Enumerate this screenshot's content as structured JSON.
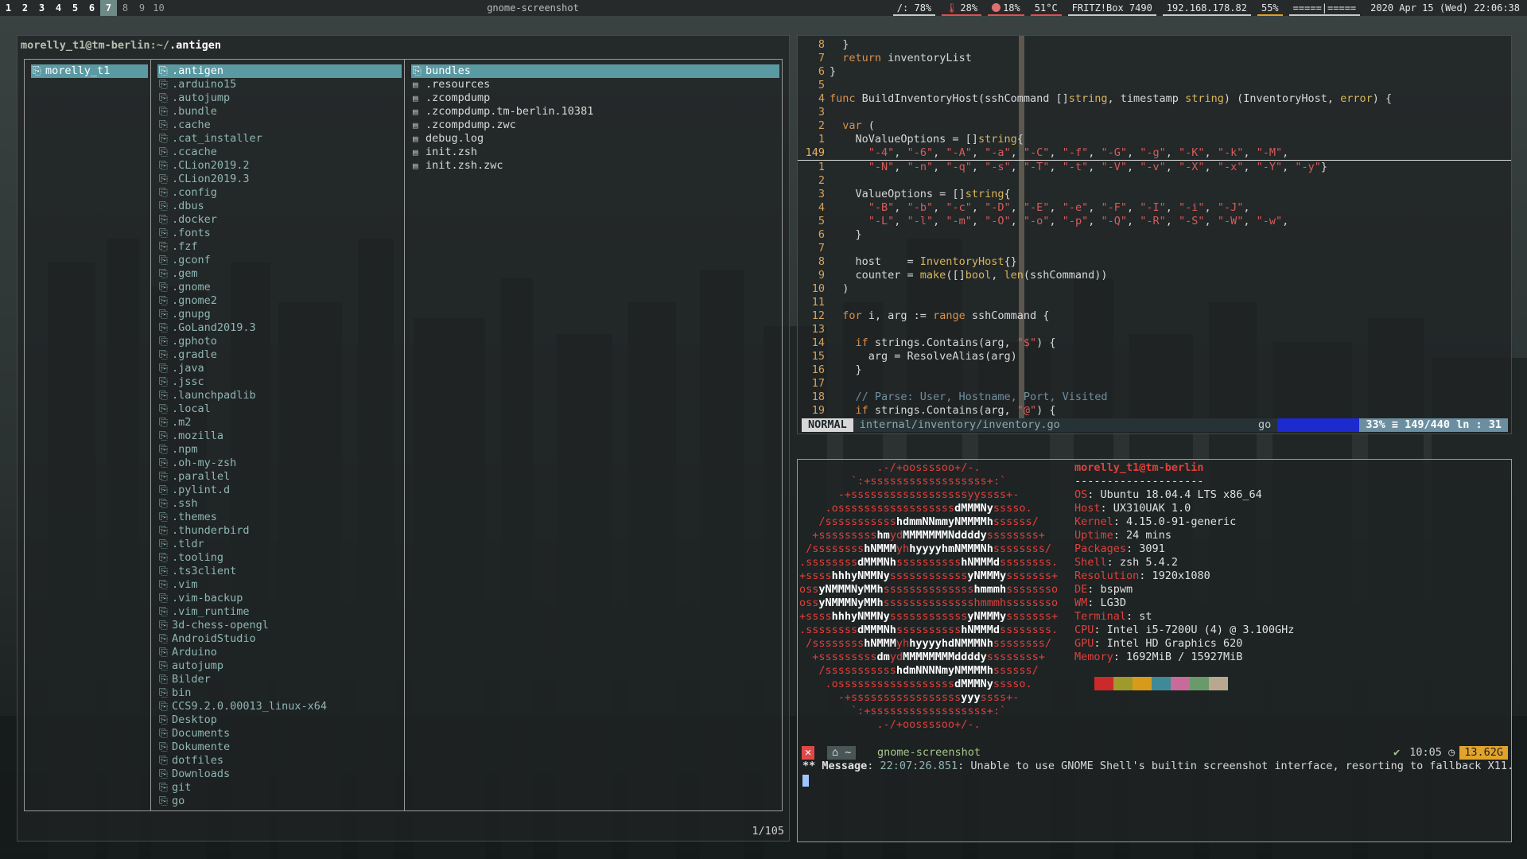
{
  "topbar": {
    "workspaces": [
      {
        "label": "1",
        "state": "occupied"
      },
      {
        "label": "2",
        "state": "occupied"
      },
      {
        "label": "3",
        "state": "occupied"
      },
      {
        "label": "4",
        "state": "occupied"
      },
      {
        "label": "5",
        "state": "occupied"
      },
      {
        "label": "6",
        "state": "occupied"
      },
      {
        "label": "7",
        "state": "active"
      },
      {
        "label": "8",
        "state": "empty"
      },
      {
        "label": "9",
        "state": "empty"
      },
      {
        "label": "10",
        "state": "empty"
      }
    ],
    "window_title": "gnome-screenshot",
    "status": {
      "disk": "/: 78%",
      "temp_percent": "28%",
      "cpu_percent": "18%",
      "cpu_temp": "51°C",
      "wifi": "FRITZ!Box 7490",
      "ip": "192.168.178.82",
      "battery": "55%",
      "volume": "=====|=====",
      "datetime": "2020 Apr 15 (Wed) 22:06:38"
    },
    "colors": {
      "disk": "#c8c8c8",
      "temp": "#e05050",
      "cpu": "#e05050",
      "cputemp": "#e05050",
      "wifi": "#c8c8c8",
      "ip": "#c8c8c8",
      "battery": "#e0a020",
      "volume": "#c8c8c8"
    }
  },
  "ranger": {
    "path_user_host": "morelly_t1@tm-berlin",
    "path_parent": ":~/",
    "path_current": ".antigen",
    "col1": [
      {
        "name": "morelly_t1",
        "type": "dir",
        "selected": true
      }
    ],
    "col2": [
      {
        "name": ".antigen",
        "selected": true
      },
      {
        "name": ".arduino15"
      },
      {
        "name": ".autojump"
      },
      {
        "name": ".bundle"
      },
      {
        "name": ".cache"
      },
      {
        "name": ".cat_installer"
      },
      {
        "name": ".ccache"
      },
      {
        "name": ".CLion2019.2"
      },
      {
        "name": ".CLion2019.3"
      },
      {
        "name": ".config"
      },
      {
        "name": ".dbus"
      },
      {
        "name": ".docker"
      },
      {
        "name": ".fonts"
      },
      {
        "name": ".fzf"
      },
      {
        "name": ".gconf"
      },
      {
        "name": ".gem"
      },
      {
        "name": ".gnome"
      },
      {
        "name": ".gnome2"
      },
      {
        "name": ".gnupg"
      },
      {
        "name": ".GoLand2019.3"
      },
      {
        "name": ".gphoto"
      },
      {
        "name": ".gradle"
      },
      {
        "name": ".java"
      },
      {
        "name": ".jssc"
      },
      {
        "name": ".launchpadlib"
      },
      {
        "name": ".local"
      },
      {
        "name": ".m2"
      },
      {
        "name": ".mozilla"
      },
      {
        "name": ".npm"
      },
      {
        "name": ".oh-my-zsh"
      },
      {
        "name": ".parallel"
      },
      {
        "name": ".pylint.d"
      },
      {
        "name": ".ssh"
      },
      {
        "name": ".themes"
      },
      {
        "name": ".thunderbird"
      },
      {
        "name": ".tldr"
      },
      {
        "name": ".tooling"
      },
      {
        "name": ".ts3client"
      },
      {
        "name": ".vim"
      },
      {
        "name": ".vim-backup"
      },
      {
        "name": ".vim_runtime"
      },
      {
        "name": "3d-chess-opengl"
      },
      {
        "name": "AndroidStudio"
      },
      {
        "name": "Arduino"
      },
      {
        "name": "autojump"
      },
      {
        "name": "Bilder"
      },
      {
        "name": "bin"
      },
      {
        "name": "CCS9.2.0.00013_linux-x64"
      },
      {
        "name": "Desktop"
      },
      {
        "name": "Documents"
      },
      {
        "name": "Dokumente"
      },
      {
        "name": "dotfiles"
      },
      {
        "name": "Downloads"
      },
      {
        "name": "git"
      },
      {
        "name": "go"
      }
    ],
    "col3": [
      {
        "name": "bundles",
        "type": "dir",
        "selected": true
      },
      {
        "name": ".resources",
        "type": "file"
      },
      {
        "name": ".zcompdump",
        "type": "file"
      },
      {
        "name": ".zcompdump.tm-berlin.10381",
        "type": "file"
      },
      {
        "name": ".zcompdump.zwc",
        "type": "file"
      },
      {
        "name": "debug.log",
        "type": "file"
      },
      {
        "name": "init.zsh",
        "type": "file"
      },
      {
        "name": "init.zsh.zwc",
        "type": "file"
      }
    ],
    "count": "1/105"
  },
  "vim": {
    "lines": [
      {
        "n": "8",
        "t": [
          [
            "tx",
            "  }"
          ]
        ]
      },
      {
        "n": "7",
        "t": [
          [
            "tx",
            "  "
          ],
          [
            "kw",
            "return"
          ],
          [
            "tx",
            " inventoryList"
          ]
        ]
      },
      {
        "n": "6",
        "t": [
          [
            "tx",
            "}"
          ]
        ]
      },
      {
        "n": "5",
        "t": [
          [
            "tx",
            ""
          ]
        ]
      },
      {
        "n": "4",
        "t": [
          [
            "kw",
            "func"
          ],
          [
            "tx",
            " BuildInventoryHost(sshCommand []"
          ],
          [
            "ty",
            "string"
          ],
          [
            "tx",
            ", timestamp "
          ],
          [
            "ty",
            "string"
          ],
          [
            "tx",
            ") (InventoryHost, "
          ],
          [
            "ty",
            "error"
          ],
          [
            "tx",
            ") {"
          ]
        ]
      },
      {
        "n": "3",
        "t": [
          [
            "tx",
            ""
          ]
        ]
      },
      {
        "n": "2",
        "t": [
          [
            "tx",
            "  "
          ],
          [
            "kw",
            "var"
          ],
          [
            "tx",
            " ("
          ]
        ]
      },
      {
        "n": "1",
        "t": [
          [
            "tx",
            "    NoValueOptions = []"
          ],
          [
            "ty",
            "string"
          ],
          [
            "tx",
            "{"
          ]
        ]
      },
      {
        "n": "149",
        "cur": true,
        "t": [
          [
            "tx",
            "      "
          ],
          [
            "str",
            "\"-4\""
          ],
          [
            "tx",
            ", "
          ],
          [
            "str",
            "\"-6\""
          ],
          [
            "tx",
            ", "
          ],
          [
            "str",
            "\"-A\""
          ],
          [
            "tx",
            ", "
          ],
          [
            "str",
            "\"-a\""
          ],
          [
            "tx",
            ", "
          ],
          [
            "str",
            "\"-C\""
          ],
          [
            "tx",
            ", "
          ],
          [
            "str",
            "\"-f\""
          ],
          [
            "tx",
            ", "
          ],
          [
            "str",
            "\"-G\""
          ],
          [
            "tx",
            ", "
          ],
          [
            "str",
            "\"-g\""
          ],
          [
            "tx",
            ", "
          ],
          [
            "str",
            "\"-K\""
          ],
          [
            "tx",
            ", "
          ],
          [
            "str",
            "\"-k\""
          ],
          [
            "tx",
            ", "
          ],
          [
            "str",
            "\"-M\""
          ],
          [
            "tx",
            ","
          ]
        ]
      },
      {
        "n": "1",
        "t": [
          [
            "tx",
            "      "
          ],
          [
            "str",
            "\"-N\""
          ],
          [
            "tx",
            ", "
          ],
          [
            "str",
            "\"-n\""
          ],
          [
            "tx",
            ", "
          ],
          [
            "str",
            "\"-q\""
          ],
          [
            "tx",
            ", "
          ],
          [
            "str",
            "\"-s\""
          ],
          [
            "tx",
            ", "
          ],
          [
            "str",
            "\"-T\""
          ],
          [
            "tx",
            ", "
          ],
          [
            "str",
            "\"-t\""
          ],
          [
            "tx",
            ", "
          ],
          [
            "str",
            "\"-V\""
          ],
          [
            "tx",
            ", "
          ],
          [
            "str",
            "\"-v\""
          ],
          [
            "tx",
            ", "
          ],
          [
            "str",
            "\"-X\""
          ],
          [
            "tx",
            ", "
          ],
          [
            "str",
            "\"-x\""
          ],
          [
            "tx",
            ", "
          ],
          [
            "str",
            "\"-Y\""
          ],
          [
            "tx",
            ", "
          ],
          [
            "str",
            "\"-y\""
          ],
          [
            "tx",
            "}"
          ]
        ]
      },
      {
        "n": "2",
        "t": [
          [
            "tx",
            ""
          ]
        ]
      },
      {
        "n": "3",
        "t": [
          [
            "tx",
            "    ValueOptions = []"
          ],
          [
            "ty",
            "string"
          ],
          [
            "tx",
            "{"
          ]
        ]
      },
      {
        "n": "4",
        "t": [
          [
            "tx",
            "      "
          ],
          [
            "str",
            "\"-B\""
          ],
          [
            "tx",
            ", "
          ],
          [
            "str",
            "\"-b\""
          ],
          [
            "tx",
            ", "
          ],
          [
            "str",
            "\"-c\""
          ],
          [
            "tx",
            ", "
          ],
          [
            "str",
            "\"-D\""
          ],
          [
            "tx",
            ", "
          ],
          [
            "str",
            "\"-E\""
          ],
          [
            "tx",
            ", "
          ],
          [
            "str",
            "\"-e\""
          ],
          [
            "tx",
            ", "
          ],
          [
            "str",
            "\"-F\""
          ],
          [
            "tx",
            ", "
          ],
          [
            "str",
            "\"-I\""
          ],
          [
            "tx",
            ", "
          ],
          [
            "str",
            "\"-i\""
          ],
          [
            "tx",
            ", "
          ],
          [
            "str",
            "\"-J\""
          ],
          [
            "tx",
            ","
          ]
        ]
      },
      {
        "n": "5",
        "t": [
          [
            "tx",
            "      "
          ],
          [
            "str",
            "\"-L\""
          ],
          [
            "tx",
            ", "
          ],
          [
            "str",
            "\"-l\""
          ],
          [
            "tx",
            ", "
          ],
          [
            "str",
            "\"-m\""
          ],
          [
            "tx",
            ", "
          ],
          [
            "str",
            "\"-O\""
          ],
          [
            "tx",
            ", "
          ],
          [
            "str",
            "\"-o\""
          ],
          [
            "tx",
            ", "
          ],
          [
            "str",
            "\"-p\""
          ],
          [
            "tx",
            ", "
          ],
          [
            "str",
            "\"-Q\""
          ],
          [
            "tx",
            ", "
          ],
          [
            "str",
            "\"-R\""
          ],
          [
            "tx",
            ", "
          ],
          [
            "str",
            "\"-S\""
          ],
          [
            "tx",
            ", "
          ],
          [
            "str",
            "\"-W\""
          ],
          [
            "tx",
            ", "
          ],
          [
            "str",
            "\"-w\""
          ],
          [
            "tx",
            ","
          ]
        ]
      },
      {
        "n": "6",
        "t": [
          [
            "tx",
            "    }"
          ]
        ]
      },
      {
        "n": "7",
        "t": [
          [
            "tx",
            ""
          ]
        ]
      },
      {
        "n": "8",
        "t": [
          [
            "tx",
            "    host    = "
          ],
          [
            "ty",
            "InventoryHost"
          ],
          [
            "tx",
            "{}"
          ]
        ]
      },
      {
        "n": "9",
        "t": [
          [
            "tx",
            "    counter = "
          ],
          [
            "ty",
            "make"
          ],
          [
            "tx",
            "([]"
          ],
          [
            "ty",
            "bool"
          ],
          [
            "tx",
            ", "
          ],
          [
            "ty",
            "len"
          ],
          [
            "tx",
            "(sshCommand))"
          ]
        ]
      },
      {
        "n": "10",
        "t": [
          [
            "tx",
            "  )"
          ]
        ]
      },
      {
        "n": "11",
        "t": [
          [
            "tx",
            ""
          ]
        ]
      },
      {
        "n": "12",
        "t": [
          [
            "tx",
            "  "
          ],
          [
            "kw",
            "for"
          ],
          [
            "tx",
            " i, arg := "
          ],
          [
            "kw",
            "range"
          ],
          [
            "tx",
            " sshCommand {"
          ]
        ]
      },
      {
        "n": "13",
        "t": [
          [
            "tx",
            ""
          ]
        ]
      },
      {
        "n": "14",
        "t": [
          [
            "tx",
            "    "
          ],
          [
            "kw",
            "if"
          ],
          [
            "tx",
            " strings.Contains(arg, "
          ],
          [
            "str",
            "\"$\""
          ],
          [
            "tx",
            ") {"
          ]
        ]
      },
      {
        "n": "15",
        "t": [
          [
            "tx",
            "      arg = ResolveAlias(arg)"
          ]
        ]
      },
      {
        "n": "16",
        "t": [
          [
            "tx",
            "    }"
          ]
        ]
      },
      {
        "n": "17",
        "t": [
          [
            "tx",
            ""
          ]
        ]
      },
      {
        "n": "18",
        "t": [
          [
            "tx",
            "    "
          ],
          [
            "cm",
            "// Parse: User, Hostname, Port, Visited"
          ]
        ]
      },
      {
        "n": "19",
        "t": [
          [
            "tx",
            "    "
          ],
          [
            "kw",
            "if"
          ],
          [
            "tx",
            " strings.Contains(arg, "
          ],
          [
            "str",
            "\"@\""
          ],
          [
            "tx",
            ") {"
          ]
        ]
      }
    ],
    "status": {
      "mode": "NORMAL",
      "file": "internal/inventory/inventory.go",
      "filetype": "go",
      "position": "33%  ≡  149/440 ln : 31"
    }
  },
  "neofetch": {
    "logo": [
      "            .-/+oossssoo+/-.",
      "        `:+ssssssssssssssssss+:`",
      "      -+ssssssssssssssssssyyssss+-",
      "    .ossssssssssssssssss[b]dMMMNy[/b]sssso.",
      "   /sssssssssss[b]hdmmNNmmyNMMMMh[/b]ssssss/",
      "  +sssssssss[b]hm[/b]yd[b]MMMMMMMNddddy[/b]ssssssss+",
      " /ssssssss[b]hNMMM[/b]yh[b]hyyyyhmNMMMNh[/b]ssssssss/",
      ".ssssssss[b]dMMMNh[/b]ssssssssss[b]hNMMMd[/b]ssssssss.",
      "+ssss[b]hhhyNMMNy[/b]ssssssssssss[b]yNMMMy[/b]sssssss+",
      "oss[b]yNMMMNyMMh[/b]ssssssssssssss[b]hmmmh[/b]ssssssso",
      "oss[b]yNMMMNyMMh[/b]sssssssssssssshmmmhssssssso",
      "+ssss[b]hhhyNMMNy[/b]ssssssssssss[b]yNMMMy[/b]sssssss+",
      ".ssssssss[b]dMMMNh[/b]ssssssssss[b]hNMMMd[/b]ssssssss.",
      " /ssssssss[b]hNMMM[/b]yh[b]hyyyyhdNMMMNh[/b]ssssssss/",
      "  +sssssssss[b]dm[/b]yd[b]MMMMMMMMddddy[/b]ssssssss+",
      "   /sssssssssss[b]hdmNNNNmyNMMMMh[/b]ssssss/",
      "    .ossssssssssssssssss[b]dMMMNy[/b]sssso.",
      "      -+sssssssssssssssss[b]yyy[/b]ssss+-",
      "        `:+ssssssssssssssssss+:`",
      "            .-/+oossssoo+/-."
    ],
    "user_host": "morelly_t1@tm-berlin",
    "separator": "--------------------",
    "fields": [
      {
        "k": "OS",
        "v": "Ubuntu 18.04.4 LTS x86_64"
      },
      {
        "k": "Host",
        "v": "UX310UAK 1.0"
      },
      {
        "k": "Kernel",
        "v": "4.15.0-91-generic"
      },
      {
        "k": "Uptime",
        "v": "24 mins"
      },
      {
        "k": "Packages",
        "v": "3091"
      },
      {
        "k": "Shell",
        "v": "zsh 5.4.2"
      },
      {
        "k": "Resolution",
        "v": "1920x1080"
      },
      {
        "k": "DE",
        "v": "bspwm"
      },
      {
        "k": "WM",
        "v": "LG3D"
      },
      {
        "k": "Terminal",
        "v": "st"
      },
      {
        "k": "CPU",
        "v": "Intel i5-7200U (4) @ 3.100GHz"
      },
      {
        "k": "GPU",
        "v": "Intel HD Graphics 620"
      },
      {
        "k": "Memory",
        "v": "1692MiB / 15927MiB"
      }
    ],
    "swatches": [
      "#cc2a2a",
      "#a09a2a",
      "#d89a1a",
      "#3f8a96",
      "#c86a9a",
      "#6a9a6a",
      "#b8a890"
    ]
  },
  "shell": {
    "err_icon": "✕",
    "dir_icon": "⌂ ~",
    "command": "gnome-screenshot",
    "ok_icon": "✔",
    "time": "10:05",
    "clock_icon": "◷",
    "memory": "13.62G",
    "message_label": "** Message",
    "message_time": "22:07:26.851",
    "message_text": ": Unable to use GNOME Shell's builtin screenshot interface, resorting to fallback X11."
  }
}
